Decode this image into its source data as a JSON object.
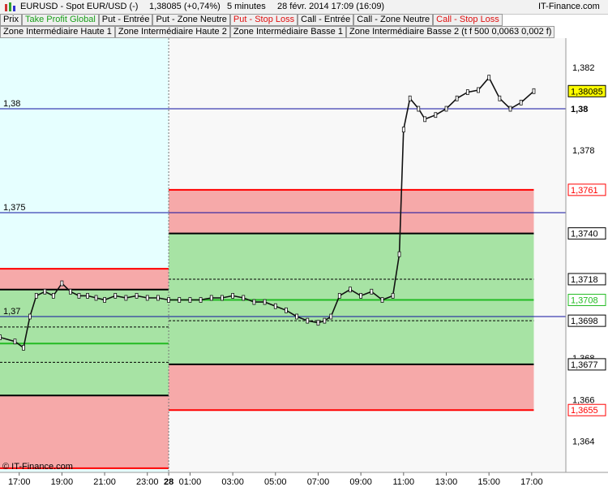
{
  "header": {
    "symbol": "EURUSD - Spot EUR/USD (-)",
    "price_change": "1,38085 (+0,74%)",
    "period": "5 minutes",
    "datetime": "28 févr. 2014 17:09 (16:09)",
    "brand": "IT-Finance.com"
  },
  "legend_row1": [
    {
      "label": "Prix",
      "color": "#000000"
    },
    {
      "label": "Take Profit Global",
      "color": "#1aa01a"
    },
    {
      "label": "Put - Entrée",
      "color": "#000000"
    },
    {
      "label": "Put - Zone Neutre",
      "color": "#000000"
    },
    {
      "label": "Put - Stop Loss",
      "color": "#e01010"
    },
    {
      "label": "Call - Entrée",
      "color": "#000000"
    },
    {
      "label": "Call - Zone Neutre",
      "color": "#000000"
    },
    {
      "label": "Call - Stop Loss",
      "color": "#e01010"
    }
  ],
  "legend_row2": [
    {
      "label": "Zone Intermédiaire Haute 1"
    },
    {
      "label": "Zone Intermédiaire Haute 2"
    },
    {
      "label": "Zone Intermédiaire Basse 1"
    },
    {
      "label": "Zone Intermédiaire Basse 2 (t f 500 0,0063 0,002 f)"
    }
  ],
  "credit": "© IT-Finance.com",
  "colors": {
    "red_zone": "#f6a9a9",
    "green_zone": "#a7e3a4",
    "cyan_bg": "#e6ffff",
    "red_line": "#ff0000",
    "green_line": "#22bb22",
    "blue_line": "#1010a0"
  },
  "chart_data": {
    "type": "candlestick",
    "y_range": [
      1.3625,
      1.3834
    ],
    "y_ticks": [
      "1,382",
      "1,38",
      "1,378",
      "1,375",
      "1,3740",
      "1,3718",
      "1,37",
      "1,368",
      "1,366",
      "1,364"
    ],
    "y_tick_values": [
      1.382,
      1.38,
      1.378,
      1.375,
      1.374,
      1.3718,
      1.37,
      1.368,
      1.366,
      1.364
    ],
    "x_labels": [
      "17:00",
      "19:00",
      "21:00",
      "23:00",
      "28",
      "01:00",
      "03:00",
      "05:00",
      "07:00",
      "09:00",
      "11:00",
      "13:00",
      "15:00",
      "17:00"
    ],
    "x_hours": [
      17,
      19,
      21,
      23,
      24,
      25,
      27,
      29,
      31,
      33,
      35,
      37,
      39,
      41
    ],
    "x_range_hours": [
      16.1,
      42.6
    ],
    "x_end_hours": 41.1,
    "session_break_hour": 24,
    "horizontal_lines": [
      1.38,
      1.375,
      1.37
    ],
    "level_labels": [
      {
        "text": "1,38085",
        "value": 1.38085,
        "style": "price"
      },
      {
        "text": "1,38",
        "value": 1.38,
        "style": "bold"
      },
      {
        "text": "1,3761",
        "value": 1.3761,
        "style": "red"
      },
      {
        "text": "1,3740",
        "value": 1.374,
        "style": "black"
      },
      {
        "text": "1,3718",
        "value": 1.3718,
        "style": "black"
      },
      {
        "text": "1,3708",
        "value": 1.3708,
        "style": "green"
      },
      {
        "text": "1,3698",
        "value": 1.3698,
        "style": "black"
      },
      {
        "text": "1,3677",
        "value": 1.3677,
        "style": "black"
      },
      {
        "text": "1,3655",
        "value": 1.3655,
        "style": "red"
      }
    ],
    "hidden_tick": "1,37",
    "zones_day1": {
      "put_stop_loss": 1.3723,
      "put_entry": 1.3713,
      "put_neutral": 1.3678,
      "take_profit": 1.3687,
      "call_neutral": 1.3695,
      "call_entry": 1.3662,
      "call_stop_loss": 1.3627
    },
    "zones_day2": {
      "put_stop_loss": 1.3761,
      "put_entry": 1.374,
      "put_neutral": 1.3718,
      "take_profit": 1.3708,
      "call_neutral": 1.3698,
      "call_entry": 1.3677,
      "call_stop_loss": 1.3655
    },
    "price_path": [
      [
        16.1,
        1.369
      ],
      [
        16.8,
        1.3688
      ],
      [
        17.2,
        1.3685
      ],
      [
        17.5,
        1.37
      ],
      [
        17.8,
        1.371
      ],
      [
        18.2,
        1.3712
      ],
      [
        18.6,
        1.371
      ],
      [
        19.0,
        1.3716
      ],
      [
        19.4,
        1.3712
      ],
      [
        19.8,
        1.371
      ],
      [
        20.2,
        1.371
      ],
      [
        20.6,
        1.3709
      ],
      [
        21.0,
        1.3708
      ],
      [
        21.5,
        1.371
      ],
      [
        22.0,
        1.3709
      ],
      [
        22.5,
        1.371
      ],
      [
        23.0,
        1.3709
      ],
      [
        23.5,
        1.3709
      ],
      [
        24.0,
        1.3708
      ],
      [
        24.5,
        1.3708
      ],
      [
        25.0,
        1.3708
      ],
      [
        25.5,
        1.3708
      ],
      [
        26.0,
        1.3709
      ],
      [
        26.5,
        1.3709
      ],
      [
        27.0,
        1.371
      ],
      [
        27.5,
        1.3709
      ],
      [
        28.0,
        1.3707
      ],
      [
        28.5,
        1.3707
      ],
      [
        29.0,
        1.3705
      ],
      [
        29.5,
        1.3703
      ],
      [
        30.0,
        1.37
      ],
      [
        30.5,
        1.3698
      ],
      [
        31.0,
        1.3697
      ],
      [
        31.3,
        1.3698
      ],
      [
        31.6,
        1.37
      ],
      [
        32.0,
        1.371
      ],
      [
        32.5,
        1.3713
      ],
      [
        33.0,
        1.371
      ],
      [
        33.5,
        1.3712
      ],
      [
        34.0,
        1.3708
      ],
      [
        34.5,
        1.371
      ],
      [
        34.8,
        1.373
      ],
      [
        35.0,
        1.379
      ],
      [
        35.3,
        1.3805
      ],
      [
        35.7,
        1.38
      ],
      [
        36.0,
        1.3795
      ],
      [
        36.5,
        1.3797
      ],
      [
        37.0,
        1.38
      ],
      [
        37.5,
        1.3805
      ],
      [
        38.0,
        1.3808
      ],
      [
        38.5,
        1.3809
      ],
      [
        39.0,
        1.3815
      ],
      [
        39.5,
        1.3805
      ],
      [
        40.0,
        1.38
      ],
      [
        40.5,
        1.3803
      ],
      [
        41.1,
        1.38085
      ]
    ]
  }
}
